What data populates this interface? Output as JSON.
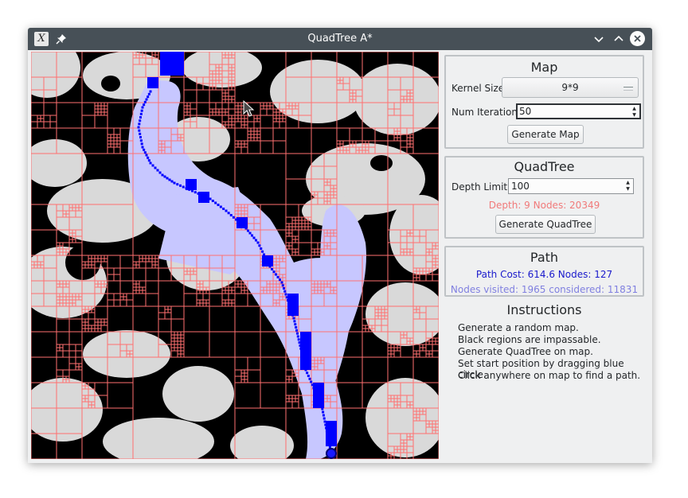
{
  "window": {
    "title": "QuadTree A*"
  },
  "map_panel": {
    "title": "Map",
    "kernel_size_label": "Kernel Size",
    "kernel_size_value": "9*9",
    "num_iterations_label": "Num Iterations",
    "num_iterations_value": "50",
    "generate_button": "Generate Map"
  },
  "quadtree_panel": {
    "title": "QuadTree",
    "depth_limit_label": "Depth Limit",
    "depth_limit_value": "100",
    "stats": "Depth: 9  Nodes: 20349",
    "generate_button": "Generate QuadTree"
  },
  "path_panel": {
    "title": "Path",
    "cost_stats": "Path Cost: 614.6  Nodes: 127",
    "visit_stats": "Nodes visited: 1965 considered: 11831"
  },
  "instructions": {
    "title": "Instructions",
    "lines": [
      "Generate a random map.",
      "Black regions are impassable.",
      "Generate QuadTree on map.",
      "Set start position by dragging blue circle.",
      "Click anywhere on map to find a path."
    ]
  },
  "colors": {
    "impassable": "#000000",
    "free": "#d9d9d9",
    "quad_line": "#ff7070",
    "visited": "#c7c7ff",
    "path": "#0000ff",
    "stats_quadtree": "#f07a7a",
    "stats_path": "#1a1acc",
    "stats_visited": "#8080e0"
  },
  "icons": [
    "app-icon",
    "pin-icon",
    "minimize-icon",
    "maximize-icon",
    "close-icon",
    "mouse-cursor-icon"
  ]
}
